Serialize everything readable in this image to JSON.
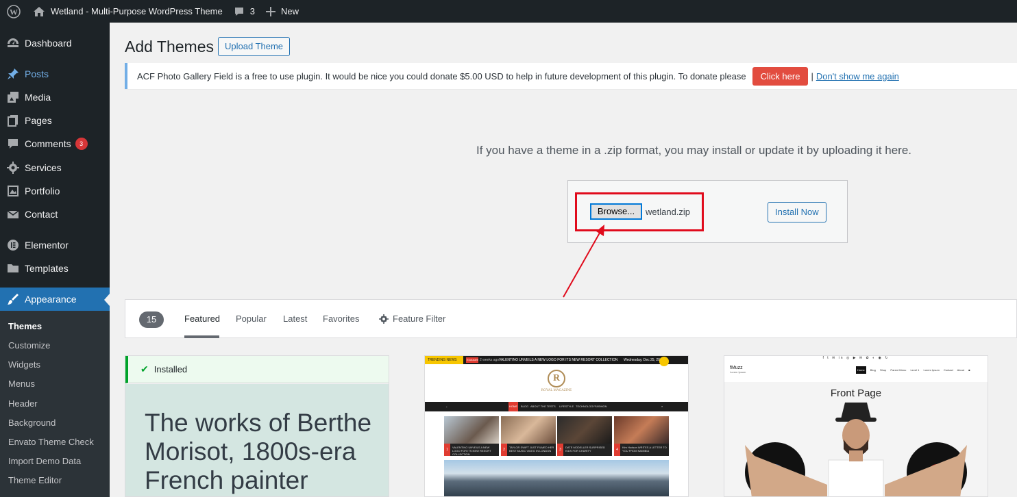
{
  "adminbar": {
    "site_name": "Wetland - Multi-Purpose WordPress Theme",
    "comments_count": "3",
    "new_label": "New"
  },
  "sidebar": {
    "items": [
      {
        "label": "Dashboard",
        "icon": "dashboard-icon"
      },
      {
        "label": "Posts",
        "icon": "pin-icon"
      },
      {
        "label": "Media",
        "icon": "media-icon"
      },
      {
        "label": "Pages",
        "icon": "pages-icon"
      },
      {
        "label": "Comments",
        "icon": "comment-icon",
        "badge": "3"
      },
      {
        "label": "Services",
        "icon": "gear-icon"
      },
      {
        "label": "Portfolio",
        "icon": "portfolio-icon"
      },
      {
        "label": "Contact",
        "icon": "mail-icon"
      },
      {
        "label": "Elementor",
        "icon": "elementor-icon"
      },
      {
        "label": "Templates",
        "icon": "folder-icon"
      },
      {
        "label": "Appearance",
        "icon": "brush-icon",
        "active": true
      }
    ],
    "submenu": [
      "Themes",
      "Customize",
      "Widgets",
      "Menus",
      "Header",
      "Background",
      "Envato Theme Check",
      "Import Demo Data",
      "Theme Editor"
    ]
  },
  "main": {
    "title": "Add Themes",
    "upload_theme_label": "Upload Theme",
    "notice": {
      "text": "ACF Photo Gallery Field is a free to use plugin. It would be nice you could donate $5.00 USD to help in future development of this plugin. To donate please",
      "click_here": "Click here",
      "separator": "|",
      "dont_show": "Don't show me again"
    },
    "upload": {
      "instructions": "If you have a theme in a .zip format, you may install or update it by uploading it here.",
      "browse_label": "Browse...",
      "file_name": "wetland.zip",
      "install_label": "Install Now"
    },
    "filter": {
      "count": "15",
      "tabs": [
        "Featured",
        "Popular",
        "Latest",
        "Favorites"
      ],
      "feature_filter": "Feature Filter"
    },
    "themes": {
      "installed_label": "Installed",
      "card1_text": "The works of Berthe Morisot, 1800s-era French painter",
      "card2": {
        "trending": "TRENDING NEWS",
        "exclusive": "Exclusive",
        "ago": "2 weeks ago",
        "headline": "VALENTINO UNVEILS A NEW LOGO FOR ITS NEW RESORT COLLECTION",
        "date": "Wednesday, Dec 25, 2019",
        "logo_letter": "R",
        "logo_name": "ROYAL MAGAZINE",
        "nav": [
          "HOME",
          "BLOG",
          "ABOUT THE TESTS",
          "LIFESTYLE",
          "TECHNOLOGY",
          "FASHION"
        ],
        "captions": [
          "VALENTINO UNVEILS A NEW LOGO FOR ITS NEW RESORT COLLECTION",
          "TAYLOR SWIFT JUST FILMED HER BEST MUSIC VIDEO IN LONDON",
          "DATE MODELLER SURPRISED KIDS FOR CHARITY",
          "Kim Hudson WRITES A LETTER TO YOU FROM NAMIBIA"
        ]
      },
      "card3": {
        "social": "f  t  ✉  in  ◎  ▶  ✉  ✿  ◐  ◉  ↻",
        "brand": "fMuzz",
        "tagline": "Lorem Ipsum",
        "nav": [
          "Home",
          "Blog",
          "Shop",
          "Parent Menu",
          "Level 1",
          "Lorem Ipsum",
          "Contact",
          "About"
        ],
        "title": "Front Page"
      }
    }
  },
  "colors": {
    "adminbar": "#1d2327",
    "accent": "#2271b1",
    "badge": "#d63638",
    "highlight": "#e00b1c"
  }
}
